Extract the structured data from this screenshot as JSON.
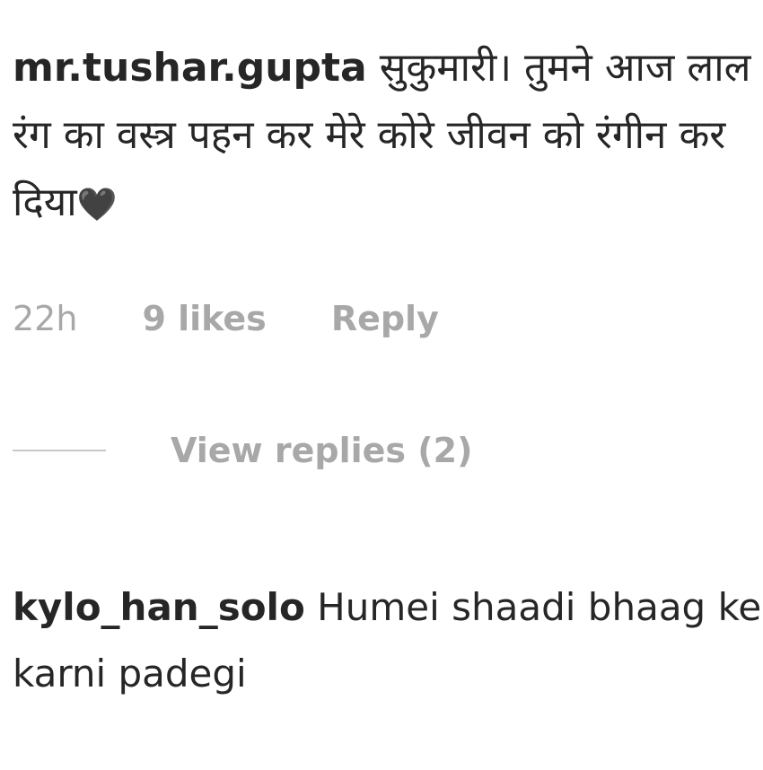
{
  "comments": [
    {
      "username": "mr.tushar.gupta",
      "text": "सुकुमारी। तुमने आज लाल रंग का वस्त्र पहन कर मेरे कोरे जीवन को रंगीन कर दिया",
      "emoji": "🖤",
      "time": "22h",
      "likes": "9 likes",
      "reply_label": "Reply",
      "view_replies_label": "View replies (2)"
    },
    {
      "username": "kylo_han_solo",
      "text": "Humei shaadi bhaag ke karni padegi"
    }
  ],
  "icons": {
    "heart": "black-heart-icon"
  }
}
